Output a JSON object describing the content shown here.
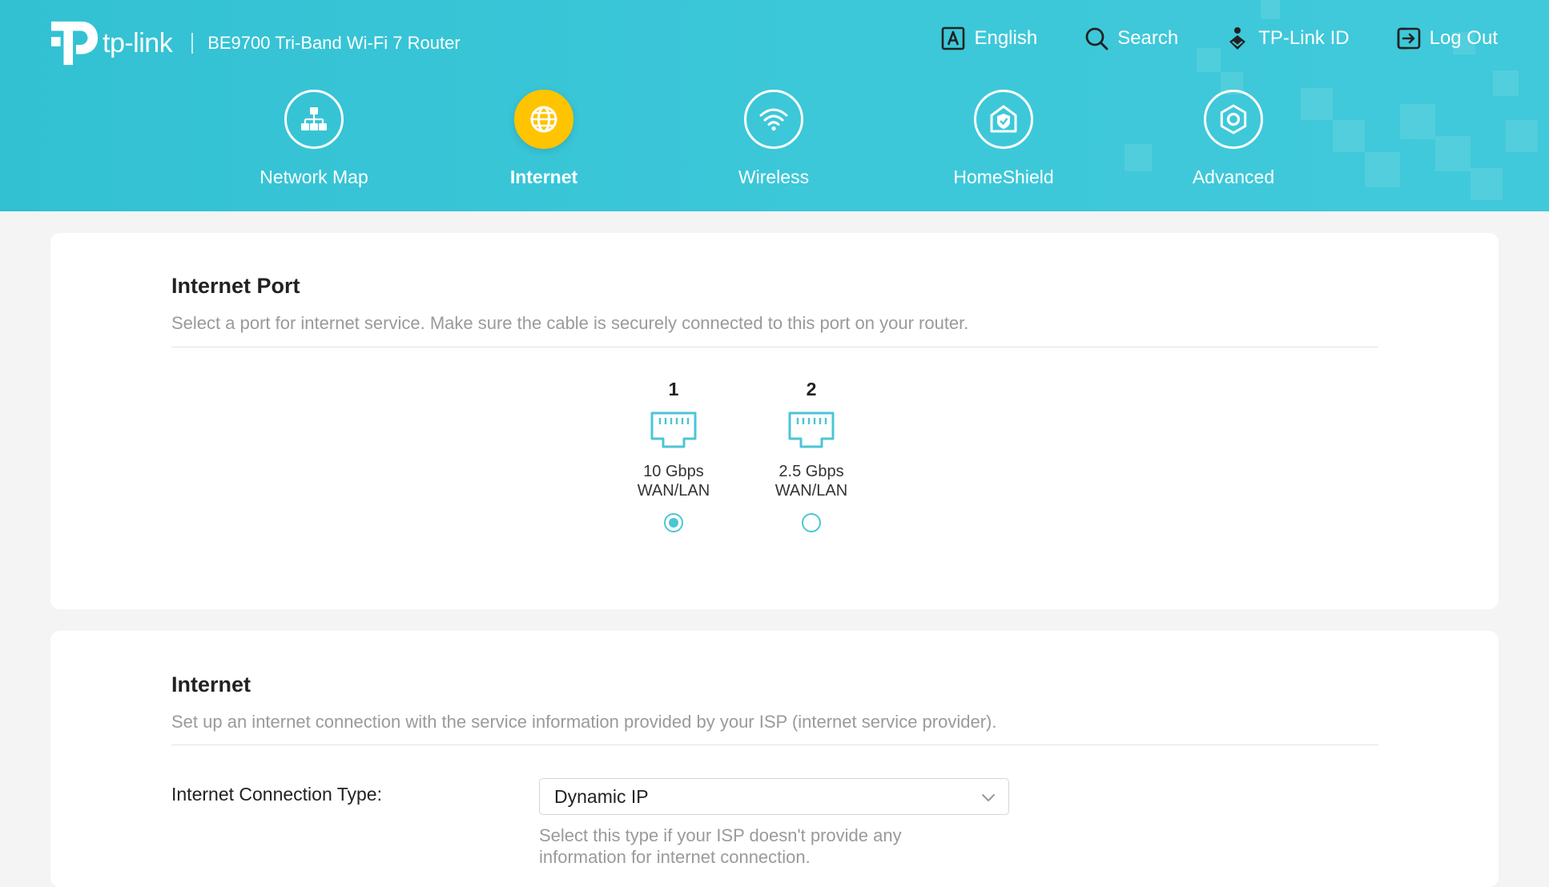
{
  "header": {
    "logo_text": "tp-link",
    "model": "BE9700 Tri-Band Wi-Fi 7 Router",
    "actions": {
      "language": {
        "label": "English",
        "icon": "language-icon"
      },
      "search": {
        "label": "Search",
        "icon": "search-icon"
      },
      "account": {
        "label": "TP-Link ID",
        "icon": "tplink-id-icon"
      },
      "logout": {
        "label": "Log Out",
        "icon": "logout-icon"
      }
    }
  },
  "nav": {
    "items": [
      {
        "label": "Network Map",
        "icon": "network-map-icon",
        "active": false
      },
      {
        "label": "Internet",
        "icon": "globe-icon",
        "active": true
      },
      {
        "label": "Wireless",
        "icon": "wifi-icon",
        "active": false
      },
      {
        "label": "HomeShield",
        "icon": "homeshield-icon",
        "active": false
      },
      {
        "label": "Advanced",
        "icon": "gear-icon",
        "active": false
      }
    ]
  },
  "internet_port": {
    "title": "Internet Port",
    "description": "Select a port for internet service. Make sure the cable is securely connected to this port on your router.",
    "ports": [
      {
        "number": "1",
        "speed": "10 Gbps",
        "type": "WAN/LAN",
        "selected": true
      },
      {
        "number": "2",
        "speed": "2.5 Gbps",
        "type": "WAN/LAN",
        "selected": false
      }
    ]
  },
  "internet": {
    "title": "Internet",
    "description": "Set up an internet connection with the service information provided by your ISP (internet service provider).",
    "connection_type_label": "Internet Connection Type:",
    "connection_type_value": "Dynamic IP",
    "connection_type_hint": "Select this type if your ISP doesn't provide any information for internet connection."
  },
  "colors": {
    "header": "#3cc8d9",
    "active_nav": "#ffc400",
    "accent": "#4cc5d4"
  }
}
